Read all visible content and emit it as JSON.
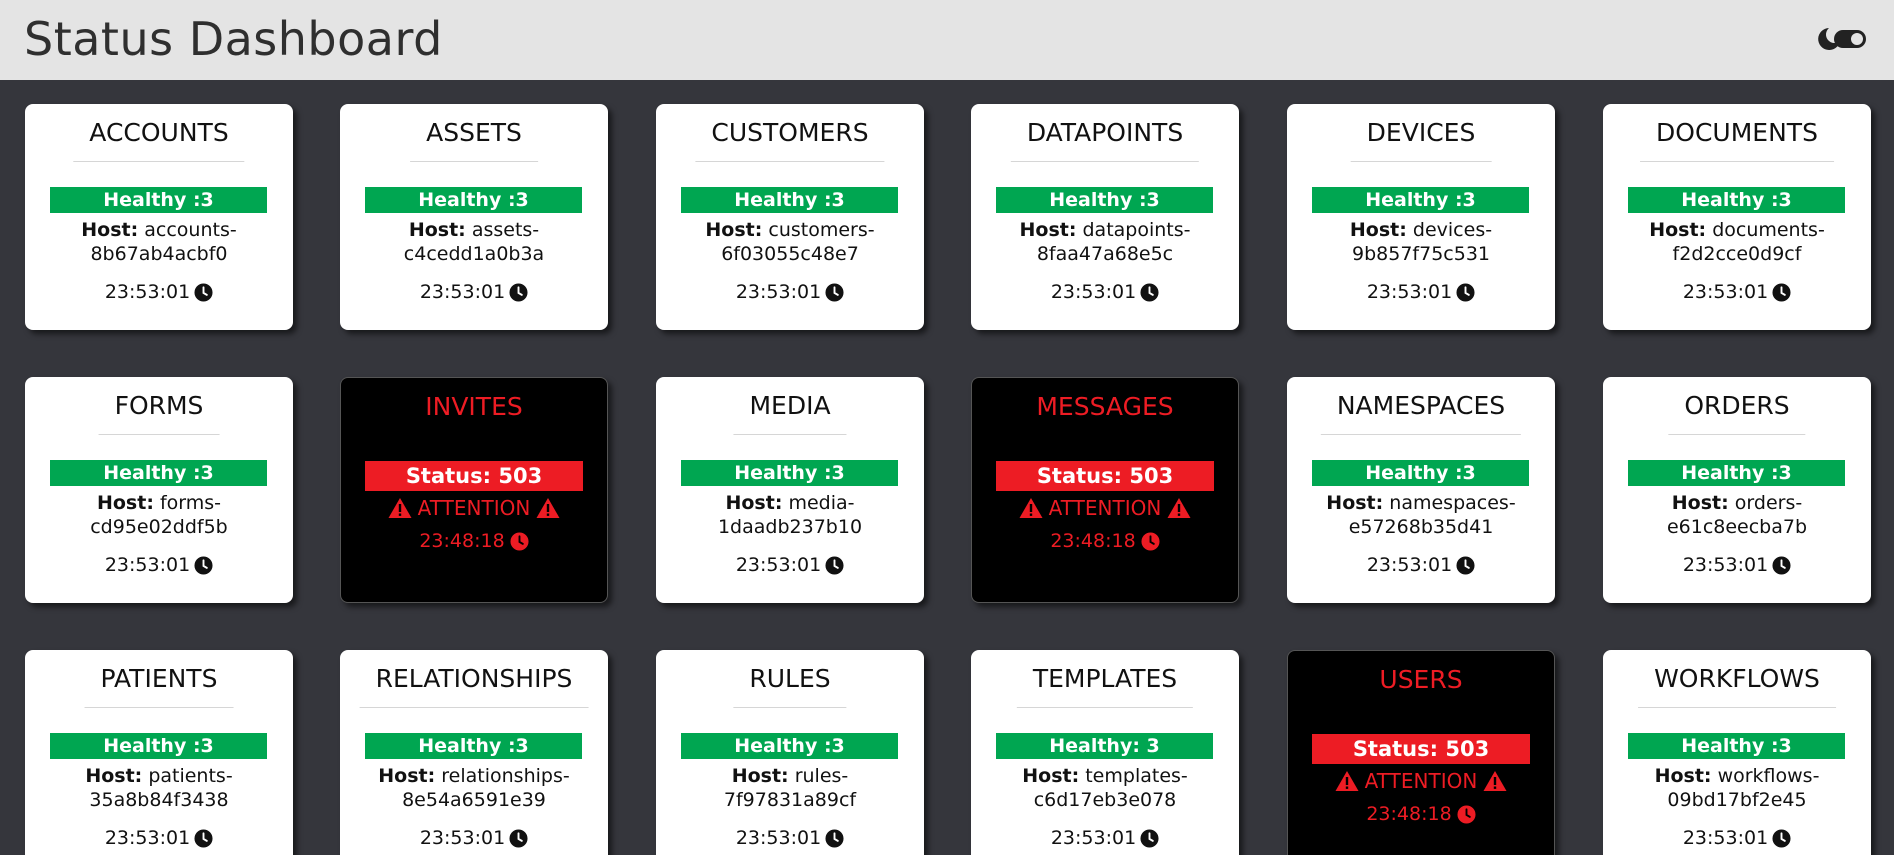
{
  "header": {
    "title": "Status Dashboard",
    "theme_toggle_icon": "theme-toggle-icon"
  },
  "colors": {
    "header_bg": "#e4e4e4",
    "page_bg": "#35363c",
    "healthy": "#00a651",
    "error": "#ed1c24",
    "card_bg": "#ffffff",
    "down_card_bg": "#000000"
  },
  "labels": {
    "host_label": "Host:",
    "attention": "ATTENTION"
  },
  "services": [
    {
      "name": "ACCOUNTS",
      "state": "healthy",
      "status": "Healthy :3",
      "host_line1": "accounts-",
      "host_line2": "8b67ab4acbf0",
      "time": "23:53:01"
    },
    {
      "name": "ASSETS",
      "state": "healthy",
      "status": "Healthy :3",
      "host_line1": "assets-",
      "host_line2": "c4cedd1a0b3a",
      "time": "23:53:01"
    },
    {
      "name": "CUSTOMERS",
      "state": "healthy",
      "status": "Healthy :3",
      "host_line1": "customers-",
      "host_line2": "6f03055c48e7",
      "time": "23:53:01"
    },
    {
      "name": "DATAPOINTS",
      "state": "healthy",
      "status": "Healthy :3",
      "host_line1": "datapoints-",
      "host_line2": "8faa47a68e5c",
      "time": "23:53:01"
    },
    {
      "name": "DEVICES",
      "state": "healthy",
      "status": "Healthy :3",
      "host_line1": "devices-",
      "host_line2": "9b857f75c531",
      "time": "23:53:01"
    },
    {
      "name": "DOCUMENTS",
      "state": "healthy",
      "status": "Healthy :3",
      "host_line1": "documents-",
      "host_line2": "f2d2cce0d9cf",
      "time": "23:53:01"
    },
    {
      "name": "FORMS",
      "state": "healthy",
      "status": "Healthy :3",
      "host_line1": "forms-",
      "host_line2": "cd95e02ddf5b",
      "time": "23:53:01"
    },
    {
      "name": "INVITES",
      "state": "down",
      "status": "Status: 503",
      "time": "23:48:18"
    },
    {
      "name": "MEDIA",
      "state": "healthy",
      "status": "Healthy :3",
      "host_line1": "media-",
      "host_line2": "1daadb237b10",
      "time": "23:53:01"
    },
    {
      "name": "MESSAGES",
      "state": "down",
      "status": "Status: 503",
      "time": "23:48:18"
    },
    {
      "name": "NAMESPACES",
      "state": "healthy",
      "status": "Healthy :3",
      "host_line1": "namespaces-",
      "host_line2": "e57268b35d41",
      "time": "23:53:01"
    },
    {
      "name": "ORDERS",
      "state": "healthy",
      "status": "Healthy :3",
      "host_line1": "orders-",
      "host_line2": "e61c8eecba7b",
      "time": "23:53:01"
    },
    {
      "name": "PATIENTS",
      "state": "healthy",
      "status": "Healthy :3",
      "host_line1": "patients-",
      "host_line2": "35a8b84f3438",
      "time": "23:53:01"
    },
    {
      "name": "RELATIONSHIPS",
      "state": "healthy",
      "status": "Healthy :3",
      "host_line1": "relationships-",
      "host_line2": "8e54a6591e39",
      "time": "23:53:01"
    },
    {
      "name": "RULES",
      "state": "healthy",
      "status": "Healthy :3",
      "host_line1": "rules-",
      "host_line2": "7f97831a89cf",
      "time": "23:53:01"
    },
    {
      "name": "TEMPLATES",
      "state": "healthy",
      "status": "Healthy: 3",
      "host_line1": "templates-",
      "host_line2": "c6d17eb3e078",
      "time": "23:53:01"
    },
    {
      "name": "USERS",
      "state": "down",
      "status": "Status: 503",
      "time": "23:48:18"
    },
    {
      "name": "WORKFLOWS",
      "state": "healthy",
      "status": "Healthy :3",
      "host_line1": "workflows-",
      "host_line2": "09bd17bf2e45",
      "time": "23:53:01"
    }
  ]
}
